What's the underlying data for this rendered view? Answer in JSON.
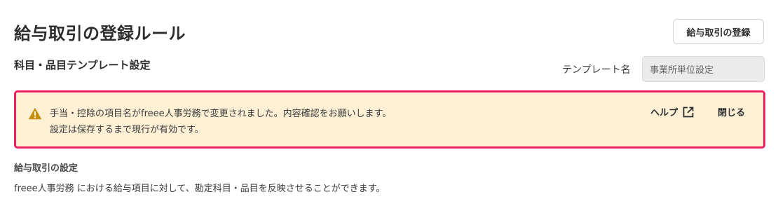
{
  "header": {
    "title": "給与取引の登録ルール",
    "register_button_label": "給与取引の登録"
  },
  "template_section": {
    "heading": "科目・品目テンプレート設定",
    "template_name_label": "テンプレート名",
    "template_name_value": "事業所単位設定"
  },
  "notice": {
    "icon": "warning-icon",
    "line1": "手当・控除の項目名がfreee人事労務で変更されました。内容確認をお願いします。",
    "line2": "設定は保存するまで現行が有効です。",
    "help_label": "ヘルプ",
    "help_icon": "external-link-icon",
    "close_label": "閉じる",
    "border_color": "#ee1f63",
    "background_color": "#fdf0d5",
    "icon_color": "#c8900a"
  },
  "payroll_section": {
    "heading": "給与取引の設定",
    "description": "freee人事労務 における給与項目に対して、勘定科目・品目を反映させることができます。"
  }
}
